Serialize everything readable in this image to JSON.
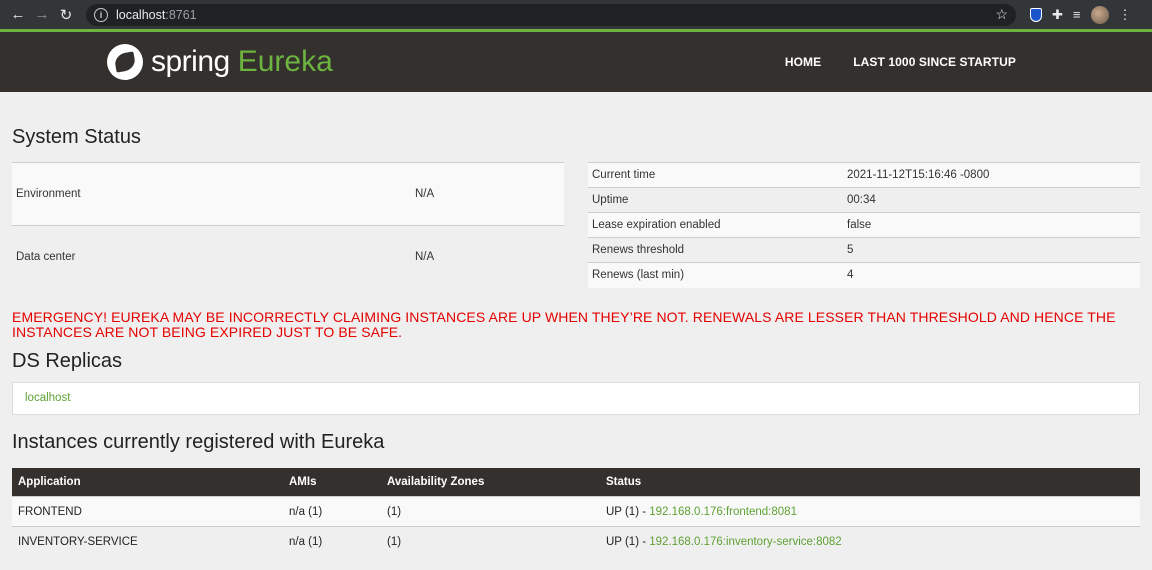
{
  "browser": {
    "url_host": "localhost",
    "url_port": ":8761"
  },
  "brand": {
    "spring": "spring",
    "eureka": "Eureka"
  },
  "nav": {
    "home": "HOME",
    "last1000": "LAST 1000 SINCE STARTUP"
  },
  "system_status": {
    "title": "System Status",
    "left": [
      {
        "key": "Environment",
        "value": "N/A"
      },
      {
        "key": "Data center",
        "value": "N/A"
      }
    ],
    "right": [
      {
        "key": "Current time",
        "value": "2021-11-12T15:16:46 -0800"
      },
      {
        "key": "Uptime",
        "value": "00:34"
      },
      {
        "key": "Lease expiration enabled",
        "value": "false"
      },
      {
        "key": "Renews threshold",
        "value": "5"
      },
      {
        "key": "Renews (last min)",
        "value": "4"
      }
    ]
  },
  "emergency": "EMERGENCY! EUREKA MAY BE INCORRECTLY CLAIMING INSTANCES ARE UP WHEN THEY’RE NOT. RENEWALS ARE LESSER THAN THRESHOLD AND HENCE THE INSTANCES ARE NOT BEING EXPIRED JUST TO BE SAFE.",
  "ds_replicas": {
    "title": "DS Replicas",
    "items": [
      "localhost"
    ]
  },
  "instances": {
    "title": "Instances currently registered with Eureka",
    "headers": [
      "Application",
      "AMIs",
      "Availability Zones",
      "Status"
    ],
    "rows": [
      {
        "application": "FRONTEND",
        "amis": "n/a (1)",
        "zones": "(1)",
        "status_prefix": "UP (1) - ",
        "status_link": "192.168.0.176:frontend:8081"
      },
      {
        "application": "INVENTORY-SERVICE",
        "amis": "n/a (1)",
        "zones": "(1)",
        "status_prefix": "UP (1) - ",
        "status_link": "192.168.0.176:inventory-service:8082"
      }
    ]
  },
  "colors": {
    "accent_green": "#6db33f",
    "navbar_bg": "#34302d",
    "emergency_red": "#e50000"
  }
}
